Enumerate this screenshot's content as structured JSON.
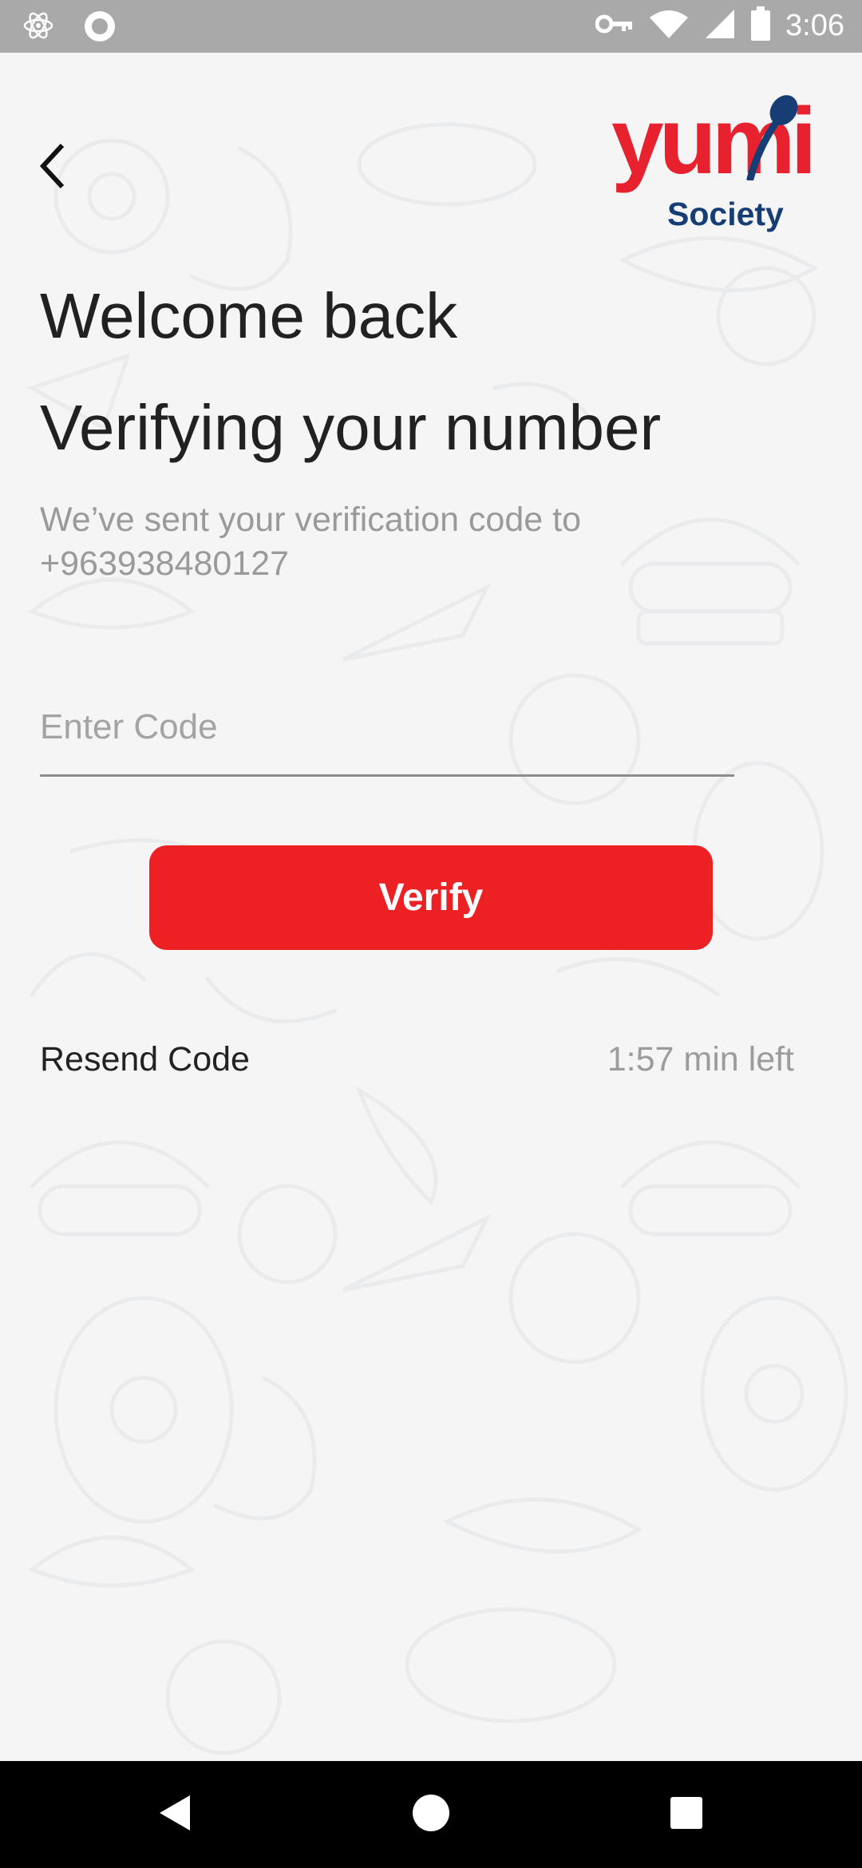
{
  "status_bar": {
    "time": "3:06",
    "icons": [
      "atom-icon",
      "circle-record-icon",
      "vpn-key-icon",
      "wifi-icon",
      "signal-icon",
      "battery-icon"
    ]
  },
  "header": {
    "back_icon": "chevron-left-icon",
    "logo": {
      "wordmark": "yumi",
      "tagline": "Society"
    }
  },
  "main": {
    "welcome": "Welcome back",
    "title": "Verifying your number",
    "subtitle_line1": "We’ve sent your verification code to",
    "phone": "+963938480127",
    "code_placeholder": "Enter Code",
    "code_value": "",
    "verify_label": "Verify",
    "resend_label": "Resend Code",
    "timer_text": "1:57 min left"
  },
  "nav_bar": {
    "icons": [
      "back-triangle-icon",
      "home-circle-icon",
      "recents-square-icon"
    ]
  },
  "colors": {
    "accent_red": "#ed2024",
    "logo_red": "#e8212f",
    "logo_blue": "#163e74",
    "background": "#f5f5f6",
    "status_bar": "#a9a9a9"
  }
}
